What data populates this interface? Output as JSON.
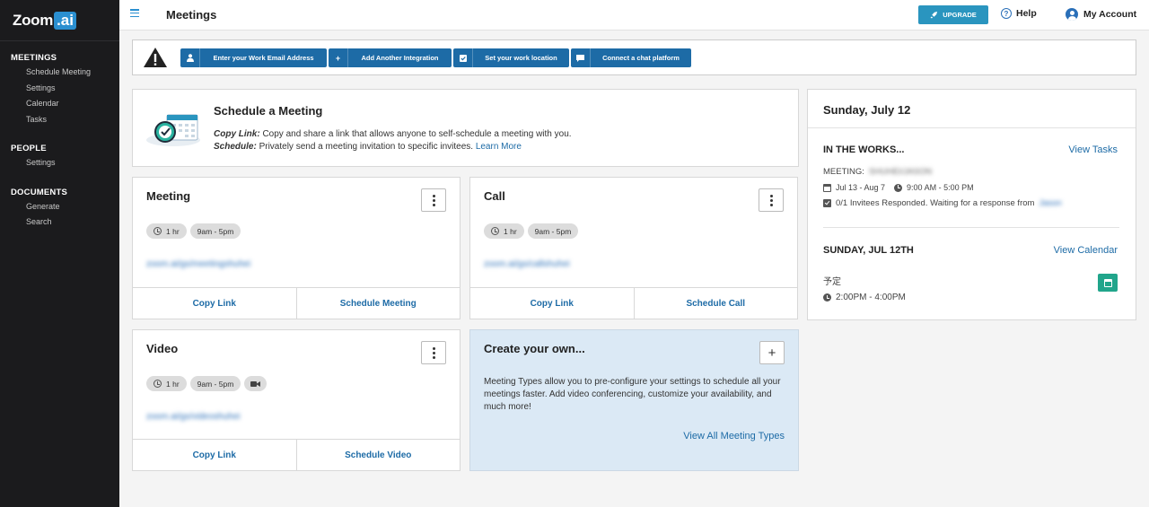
{
  "brand": {
    "name": "Zoom",
    "badge": ".ai"
  },
  "sidebar": {
    "sections": [
      {
        "title": "MEETINGS",
        "items": [
          "Schedule Meeting",
          "Settings",
          "Calendar",
          "Tasks"
        ]
      },
      {
        "title": "PEOPLE",
        "items": [
          "Settings"
        ]
      },
      {
        "title": "DOCUMENTS",
        "items": [
          "Generate",
          "Search"
        ]
      }
    ]
  },
  "header": {
    "title": "Meetings",
    "upgrade_label": "UPGRADE",
    "help_label": "Help",
    "account_label": "My Account"
  },
  "integrations": [
    {
      "label": "Enter your Work Email Address",
      "icon": "user-icon"
    },
    {
      "label": "Add Another Integration",
      "icon": "plus-icon"
    },
    {
      "label": "Set your work location",
      "icon": "checkbox-icon"
    },
    {
      "label": "Connect a chat platform",
      "icon": "chat-icon"
    }
  ],
  "schedule": {
    "title": "Schedule a Meeting",
    "copy_link_label": "Copy Link:",
    "copy_link_text": "Copy and share a link that allows anyone to self-schedule a meeting with you.",
    "schedule_label": "Schedule:",
    "schedule_text": "Privately send a meeting invitation to specific invitees.",
    "learn_more": "Learn More"
  },
  "meeting_types": [
    {
      "title": "Meeting",
      "duration": "1 hr",
      "hours": "9am - 5pm",
      "link": "zoom.ai/gs/meetingshuhei",
      "copy": "Copy Link",
      "action": "Schedule Meeting",
      "video": false
    },
    {
      "title": "Call",
      "duration": "1 hr",
      "hours": "9am - 5pm",
      "link": "zoom.ai/gs/callshuhei",
      "copy": "Copy Link",
      "action": "Schedule Call",
      "video": false
    },
    {
      "title": "Video",
      "duration": "1 hr",
      "hours": "9am - 5pm",
      "link": "zoom.ai/gs/videoshuhei",
      "copy": "Copy Link",
      "action": "Schedule Video",
      "video": true
    }
  ],
  "create": {
    "title": "Create your own...",
    "description": "Meeting Types allow you to pre-configure your settings to schedule all your meetings faster. Add video conferencing, customize your availability, and much more!",
    "link": "View All Meeting Types"
  },
  "panel": {
    "date": "Sunday, July 12",
    "works_heading": "IN THE WORKS...",
    "view_tasks": "View Tasks",
    "meeting_label": "MEETING:",
    "meeting_name": "SHUHEI/JASON",
    "date_range": "Jul 13 - Aug 7",
    "time_range": "9:00 AM - 5:00 PM",
    "invitees": "0/1 Invitees Responded. Waiting for a response from",
    "invitee_name": "Jason",
    "day_heading": "SUNDAY, JUL 12TH",
    "view_calendar": "View Calendar",
    "event_title": "予定",
    "event_time": "2:00PM - 4:00PM"
  },
  "colors": {
    "sidebar": "#1b1b1d",
    "primary": "#1d6ba6",
    "upgrade": "#2a95bf",
    "event": "#21a58b",
    "create_bg": "#dbe9f5"
  }
}
